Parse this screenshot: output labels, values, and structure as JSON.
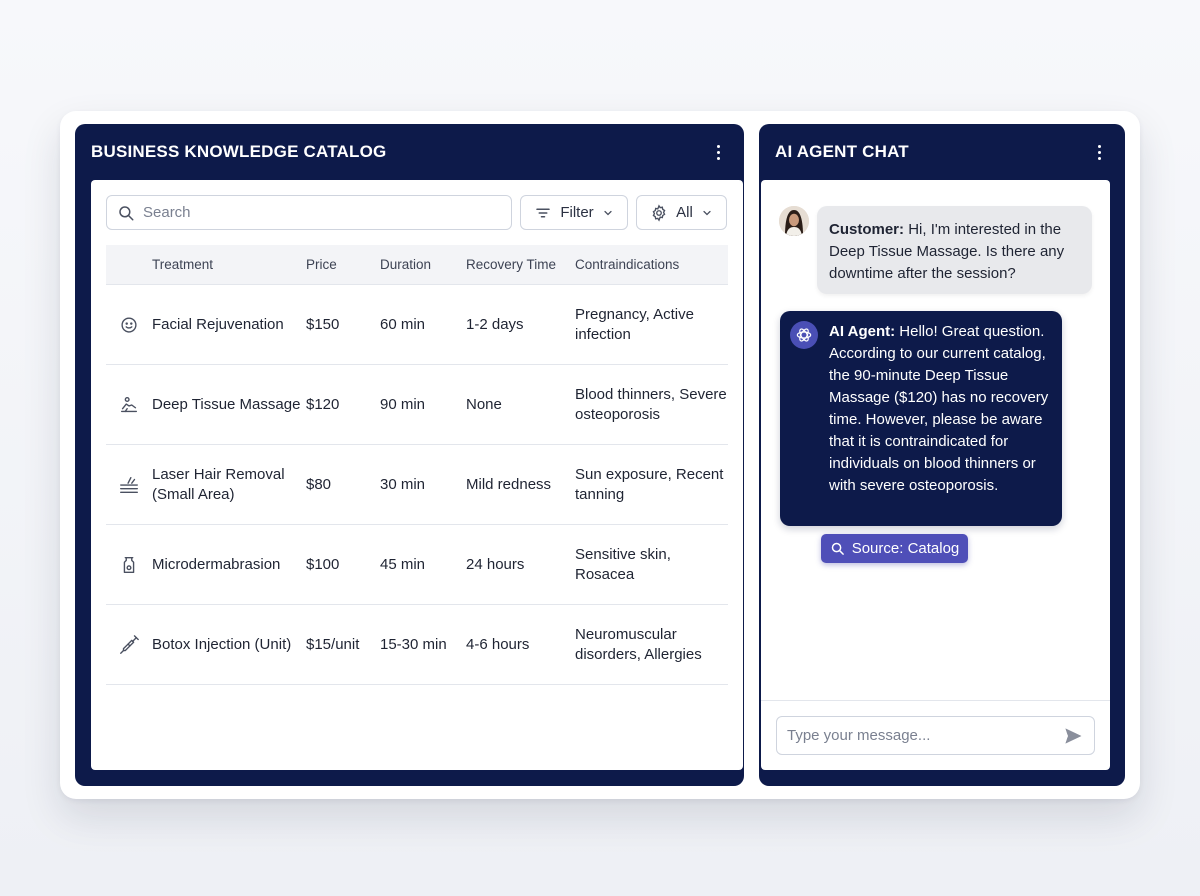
{
  "catalog": {
    "title": "BUSINESS KNOWLEDGE CATALOG",
    "search_placeholder": "Search",
    "filter_label": "Filter",
    "all_label": "All",
    "columns": [
      "Treatment",
      "Price",
      "Duration",
      "Recovery Time",
      "Contraindications"
    ],
    "rows": [
      {
        "icon": "face-icon",
        "treatment": "Facial Rejuvenation",
        "price": "$150",
        "duration": "60 min",
        "recovery": "1-2 days",
        "contraindications": "Pregnancy, Active infection"
      },
      {
        "icon": "massage-icon",
        "treatment": "Deep Tissue Massage",
        "price": "$120",
        "duration": "90 min",
        "recovery": "None",
        "contraindications": "Blood thinners, Severe osteoporosis"
      },
      {
        "icon": "laser-icon",
        "treatment": "Laser Hair Removal (Small Area)",
        "price": "$80",
        "duration": "30 min",
        "recovery": "Mild redness",
        "contraindications": "Sun exposure, Recent tanning"
      },
      {
        "icon": "skin-bottle-icon",
        "treatment": "Microdermabrasion",
        "price": "$100",
        "duration": "45 min",
        "recovery": "24 hours",
        "contraindications": "Sensitive skin, Rosacea"
      },
      {
        "icon": "syringe-icon",
        "treatment": "Botox Injection (Unit)",
        "price": "$15/unit",
        "duration": "15-30 min",
        "recovery": "4-6 hours",
        "contraindications": "Neuromuscular disorders, Allergies"
      }
    ]
  },
  "chat": {
    "title": "AI AGENT CHAT",
    "customer_label": "Customer:",
    "customer_message": "Hi, I'm interested in the Deep Tissue Massage. Is there any downtime after the session?",
    "agent_label": "AI Agent:",
    "agent_message": "Hello! Great question. According to our current catalog, the 90-minute Deep Tissue Massage ($120) has no recovery time. However, please be aware that it is contraindicated for individuals on blood thinners or with severe osteoporosis.",
    "source_label": "Source: Catalog",
    "input_placeholder": "Type your message..."
  },
  "colors": {
    "panel_navy": "#0d1a4a",
    "source_accent": "#4f4fb8",
    "customer_bubble": "#e8e9ec"
  }
}
